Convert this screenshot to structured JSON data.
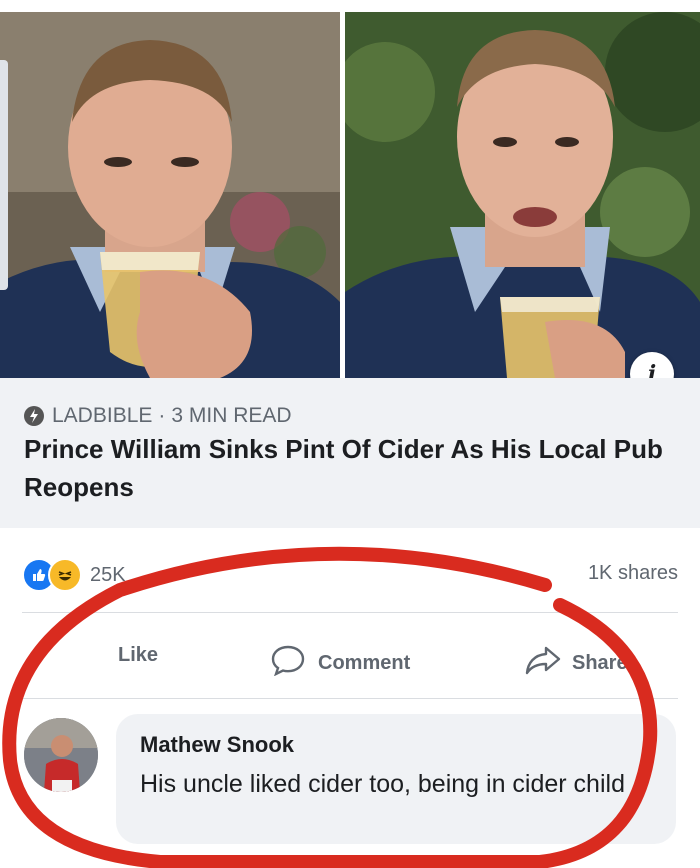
{
  "post": {
    "images": [
      {
        "subject": "man-drinking-cider"
      },
      {
        "subject": "man-holding-pint"
      }
    ],
    "info_icon": "info-icon",
    "source": "LADBIBLE",
    "separator": "·",
    "read_time": "3 MIN READ",
    "headline": "Prince William Sinks Pint Of Cider As His Local Pub Reopens"
  },
  "engagement": {
    "reaction_icons": [
      "like-icon",
      "haha-icon"
    ],
    "reaction_count": "25K",
    "shares_text": "1K shares",
    "actions": {
      "like": "Like",
      "comment": "Comment",
      "share": "Share"
    }
  },
  "comment": {
    "author": "Mathew Snook",
    "text": "His uncle liked cider too, being in cider child"
  },
  "colors": {
    "accent": "#1877f2",
    "annotation": "#d92b1f"
  }
}
